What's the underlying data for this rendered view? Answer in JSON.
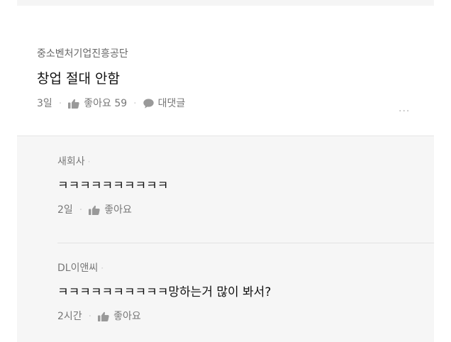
{
  "post": {
    "company": "중소벤처기업진흥공단",
    "text": "창업 절대 안함",
    "time": "3일",
    "like_label": "좋아요 59",
    "reply_label": "대댓글",
    "more_label": "···"
  },
  "replies": [
    {
      "author": "새회사",
      "text": "ㅋㅋㅋㅋㅋㅋㅋㅋㅋㅋ",
      "time": "2일",
      "like_label": "좋아요"
    },
    {
      "author": "DL이앤씨",
      "text": "ㅋㅋㅋㅋㅋㅋㅋㅋㅋㅋ망하는거 많이 봐서?",
      "time": "2시간",
      "like_label": "좋아요"
    }
  ],
  "separator": "·",
  "colors": {
    "icon": "#999999",
    "reply_bg": "#f6f6f6"
  }
}
